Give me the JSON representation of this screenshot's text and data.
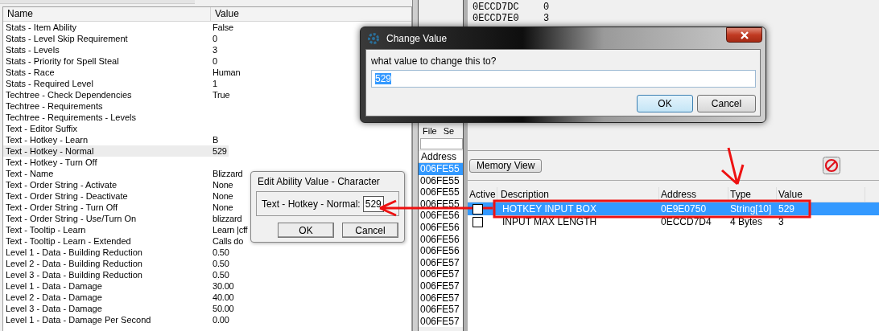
{
  "properties_table": {
    "columns": [
      "Name",
      "Value"
    ],
    "rows": [
      {
        "name": "Stats - Item Ability",
        "value": "False",
        "selected": false
      },
      {
        "name": "Stats - Level Skip Requirement",
        "value": "0",
        "selected": false
      },
      {
        "name": "Stats - Levels",
        "value": "3",
        "selected": false
      },
      {
        "name": "Stats - Priority for Spell Steal",
        "value": "0",
        "selected": false
      },
      {
        "name": "Stats - Race",
        "value": "Human",
        "selected": false
      },
      {
        "name": "Stats - Required Level",
        "value": "1",
        "selected": false
      },
      {
        "name": "Techtree - Check Dependencies",
        "value": "True",
        "selected": false
      },
      {
        "name": "Techtree - Requirements",
        "value": "",
        "selected": false
      },
      {
        "name": "Techtree - Requirements - Levels",
        "value": "",
        "selected": false
      },
      {
        "name": "Text - Editor Suffix",
        "value": "",
        "selected": false
      },
      {
        "name": "Text - Hotkey - Learn",
        "value": "B",
        "selected": false
      },
      {
        "name": "Text - Hotkey - Normal",
        "value": "529",
        "selected": true
      },
      {
        "name": "Text - Hotkey - Turn Off",
        "value": "",
        "selected": false
      },
      {
        "name": "Text - Name",
        "value": "Blizzard",
        "selected": false
      },
      {
        "name": "Text - Order String - Activate",
        "value": "None",
        "selected": false
      },
      {
        "name": "Text - Order String - Deactivate",
        "value": "None",
        "selected": false
      },
      {
        "name": "Text - Order String - Turn Off",
        "value": "None",
        "selected": false
      },
      {
        "name": "Text - Order String - Use/Turn On",
        "value": "blizzard",
        "selected": false
      },
      {
        "name": "Text - Tooltip - Learn",
        "value": "Learn |cff",
        "selected": false
      },
      {
        "name": "Text - Tooltip - Learn - Extended",
        "value": "Calls do",
        "selected": false
      },
      {
        "name": "Level 1 - Data - Building Reduction",
        "value": "0.50",
        "selected": false
      },
      {
        "name": "Level 2 - Data - Building Reduction",
        "value": "0.50",
        "selected": false
      },
      {
        "name": "Level 3 - Data - Building Reduction",
        "value": "0.50",
        "selected": false
      },
      {
        "name": "Level 1 - Data - Damage",
        "value": "30.00",
        "selected": false
      },
      {
        "name": "Level 2 - Data - Damage",
        "value": "40.00",
        "selected": false
      },
      {
        "name": "Level 3 - Data - Damage",
        "value": "50.00",
        "selected": false
      },
      {
        "name": "Level 1 - Data - Damage Per Second",
        "value": "0.00",
        "selected": false
      }
    ]
  },
  "memory_dump": [
    {
      "address": "0ECCD7DC",
      "value": "0"
    },
    {
      "address": "0ECCD7E0",
      "value": "3"
    }
  ],
  "process_panel": {
    "menu": [
      "File",
      "Se"
    ],
    "address_header": "Address",
    "addresses": [
      {
        "text": "006FE55",
        "selected": true
      },
      {
        "text": "006FE55",
        "selected": false
      },
      {
        "text": "006FE55",
        "selected": false
      },
      {
        "text": "006FE55",
        "selected": false
      },
      {
        "text": "006FE56",
        "selected": false
      },
      {
        "text": "006FE56",
        "selected": false
      },
      {
        "text": "006FE56",
        "selected": false
      },
      {
        "text": "006FE56",
        "selected": false
      },
      {
        "text": "006FE57",
        "selected": false
      },
      {
        "text": "006FE57",
        "selected": false
      },
      {
        "text": "006FE57",
        "selected": false
      },
      {
        "text": "006FE57",
        "selected": false
      },
      {
        "text": "006FE57",
        "selected": false
      },
      {
        "text": "006FE57",
        "selected": false
      }
    ]
  },
  "cheat_table": {
    "memory_view_button": "Memory View",
    "columns": [
      "Active",
      "Description",
      "Address",
      "Type",
      "Value"
    ],
    "rows": [
      {
        "active": false,
        "selected": true,
        "description": "HOTKEY INPUT BOX",
        "address": "0E9E0750",
        "type": "String[10]",
        "value": "529"
      },
      {
        "active": false,
        "selected": false,
        "description": "INPUT MAX LENGTH",
        "address": "0ECCD7D4",
        "type": "4 Bytes",
        "value": "3"
      }
    ]
  },
  "change_value_dialog": {
    "title": "Change Value",
    "prompt": "what value to change this to?",
    "value": "529",
    "buttons": [
      {
        "label": "OK",
        "focused": true
      },
      {
        "label": "Cancel",
        "focused": false
      }
    ]
  },
  "edit_dialog": {
    "title": "Edit Ability Value - Character",
    "label": "Text - Hotkey - Normal:",
    "value": "529",
    "buttons": [
      "OK",
      "Cancel"
    ]
  }
}
